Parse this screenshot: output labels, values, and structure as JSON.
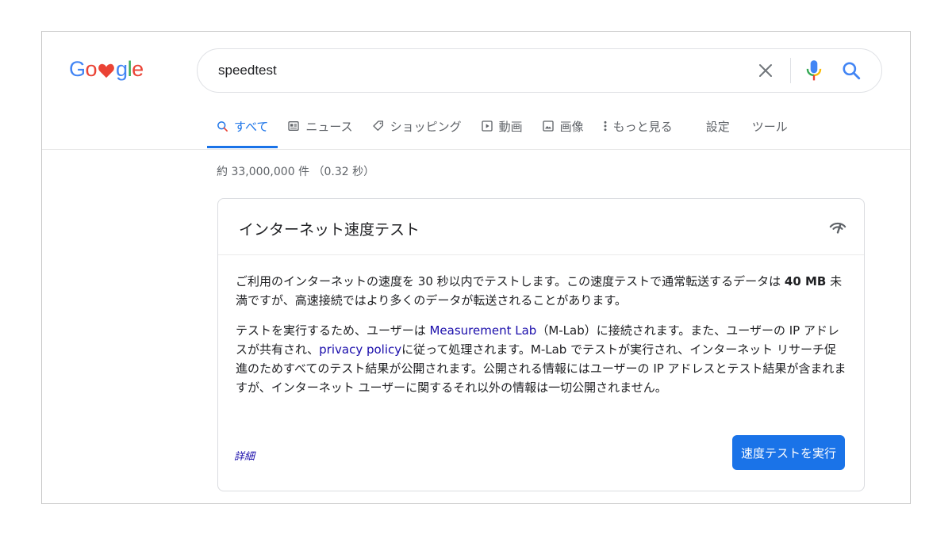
{
  "logo": {
    "letters": [
      "G",
      "o",
      "g",
      "l",
      "e"
    ],
    "heart_icon": "heart-icon",
    "colors": {
      "blue": "#4285f4",
      "red": "#ea4335",
      "yellow": "#fbbc05",
      "green": "#34a853"
    }
  },
  "search": {
    "query": "speedtest",
    "icons": {
      "clear": "close-icon",
      "voice": "mic-icon",
      "submit": "search-icon"
    }
  },
  "tabs": [
    {
      "label": "すべて",
      "icon": "search-icon",
      "active": true
    },
    {
      "label": "ニュース",
      "icon": "news-icon"
    },
    {
      "label": "ショッピング",
      "icon": "tag-icon"
    },
    {
      "label": "動画",
      "icon": "play-icon"
    },
    {
      "label": "画像",
      "icon": "image-icon"
    },
    {
      "label": "もっと見る",
      "icon": "more-vert-icon"
    }
  ],
  "tools": {
    "settings_label": "設定",
    "tools_label": "ツール"
  },
  "results": {
    "stats": "約 33,000,000 件 （0.32 秒）"
  },
  "card": {
    "title": "インターネット速度テスト",
    "icon": "speedometer-icon",
    "p1_a": "ご利用のインターネットの速度を 30 秒以内でテストします。この速度テストで通常転送するデータは ",
    "p1_bold": "40 MB",
    "p1_b": " 未満ですが、高速接続ではより多くのデータが転送されることがあります。",
    "p2_a": "テストを実行するため、ユーザーは ",
    "p2_link1": "Measurement Lab",
    "p2_b": "（M-Lab）に接続されます。また、ユーザーの IP アドレスが共有され、",
    "p2_link2": "privacy policy",
    "p2_c": "に従って処理されます。M-Lab でテストが実行され、インターネット リサーチ促進のためすべてのテスト結果が公開されます。公開される情報にはユーザーの IP アドレスとテスト結果が含まれますが、インターネット ユーザーに関するそれ以外の情報は一切公開されません。",
    "details_label": "詳細",
    "run_button_label": "速度テストを実行"
  },
  "colors": {
    "accent": "#1a73e8",
    "link": "#1a0dab",
    "muted_text": "#5f6368"
  }
}
